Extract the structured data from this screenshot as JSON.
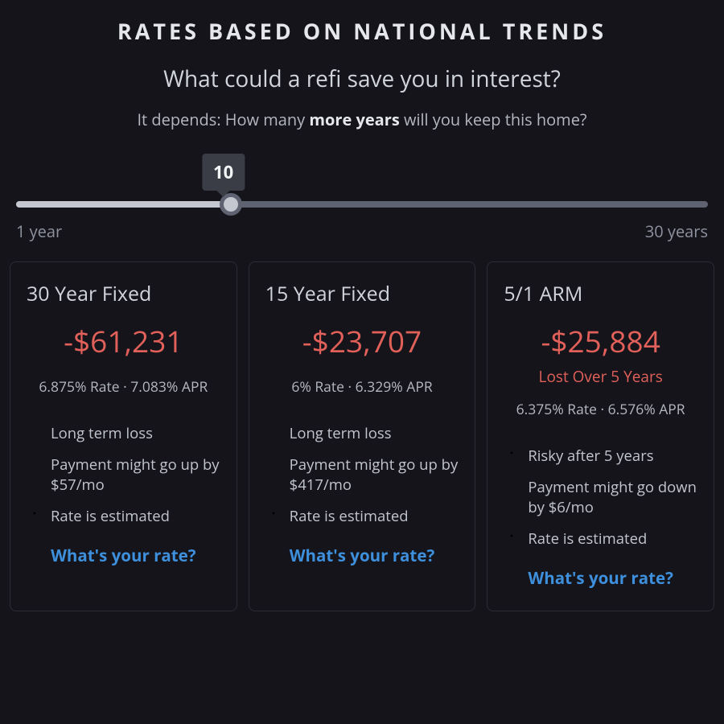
{
  "header": {
    "eyebrow": "RATES BASED ON NATIONAL TRENDS",
    "title": "What could a refi save you in interest?",
    "subline_pre": "It depends: How many ",
    "subline_bold": "more years",
    "subline_post": " will you keep this home?"
  },
  "slider": {
    "value": "10",
    "percent": 31,
    "min_label": "1 year",
    "max_label": "30 years"
  },
  "link_label": "What's your rate?",
  "cards": [
    {
      "title": "30 Year Fixed",
      "amount": "-$61,231",
      "subamount": "",
      "rate_line": "6.875% Rate · 7.083% APR",
      "bullets": [
        {
          "icon": "error",
          "text": "Long term loss"
        },
        {
          "icon": "error",
          "text": "Payment might go up by $57/mo"
        },
        {
          "icon": "info",
          "text": "Rate is estimated"
        }
      ]
    },
    {
      "title": "15 Year Fixed",
      "amount": "-$23,707",
      "subamount": "",
      "rate_line": "6% Rate · 6.329% APR",
      "bullets": [
        {
          "icon": "error",
          "text": "Long term loss"
        },
        {
          "icon": "error",
          "text": "Payment might go up by $417/mo"
        },
        {
          "icon": "info",
          "text": "Rate is estimated"
        }
      ]
    },
    {
      "title": "5/1 ARM",
      "amount": "-$25,884",
      "subamount": "Lost Over 5 Years",
      "rate_line": "6.375% Rate · 6.576% APR",
      "bullets": [
        {
          "icon": "info-orange",
          "text": "Risky after 5 years"
        },
        {
          "icon": "ok",
          "text": "Payment might go down by $6/mo"
        },
        {
          "icon": "info",
          "text": "Rate is estimated"
        }
      ]
    }
  ]
}
